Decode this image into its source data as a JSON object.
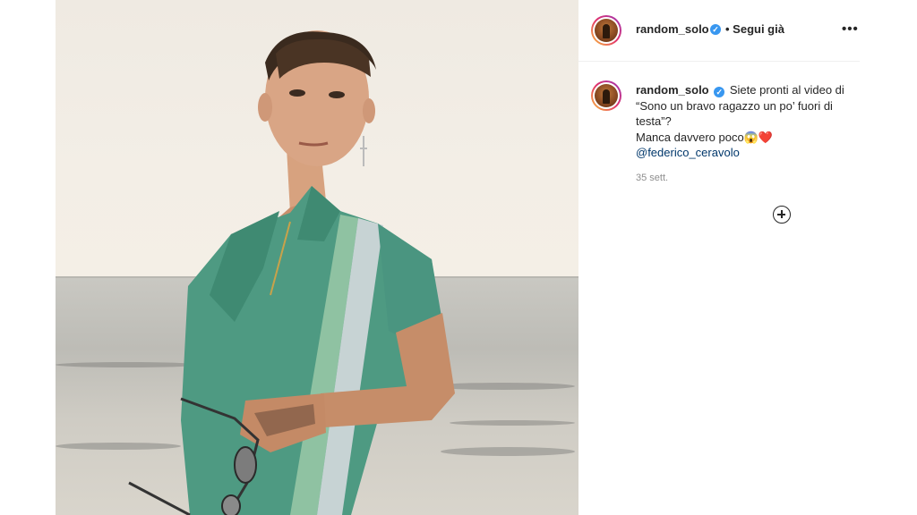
{
  "post": {
    "author": "random_solo",
    "follow_status": "• Segui già",
    "more_options": "•••",
    "caption": {
      "author": "random_solo",
      "line1": "Siete pronti al video di",
      "line2": "“Sono un bravo ragazzo un po’ fuori di",
      "line3": "testa”?",
      "line4": "Manca davvero poco😱❤️",
      "mention": "@federico_ceravolo"
    },
    "timestamp": "35 sett.",
    "verified_mark": "✓",
    "icons": [
      "verified-badge-icon",
      "more-options-icon",
      "load-more-comments-icon"
    ],
    "colors": {
      "verified": "#3897f0",
      "mention": "#00376b",
      "shirt": "#4e9a82"
    }
  }
}
